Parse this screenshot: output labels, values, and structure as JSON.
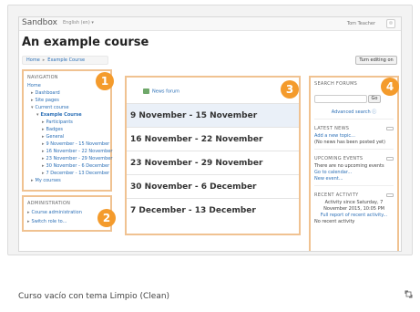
{
  "topbar": {
    "brand": "Sandbox",
    "language": "English (en) ▾",
    "user": "Tom Teacher"
  },
  "course": {
    "title": "An example course",
    "breadcrumb": [
      "Home",
      "Example Course"
    ],
    "edit_button": "Turn editing on"
  },
  "navigation": {
    "heading": "NAVIGATION",
    "items": [
      {
        "label": "Home",
        "level": 0
      },
      {
        "label": "Dashboard",
        "level": 1
      },
      {
        "label": "Site pages",
        "level": 1
      },
      {
        "label": "Current course",
        "level": 1
      },
      {
        "label": "Example Course",
        "level": 2
      },
      {
        "label": "Participants",
        "level": 3
      },
      {
        "label": "Badges",
        "level": 3
      },
      {
        "label": "General",
        "level": 3
      },
      {
        "label": "9 November - 15 November",
        "level": 3
      },
      {
        "label": "16 November - 22 November",
        "level": 3
      },
      {
        "label": "23 November - 29 November",
        "level": 3
      },
      {
        "label": "30 November - 6 December",
        "level": 3
      },
      {
        "label": "7 December - 13 December",
        "level": 3
      },
      {
        "label": "My courses",
        "level": 1
      }
    ]
  },
  "administration": {
    "heading": "ADMINISTRATION",
    "items": [
      "Course administration",
      "Switch role to..."
    ]
  },
  "main": {
    "news_forum": "News forum",
    "weeks": [
      "9 November - 15 November",
      "16 November - 22 November",
      "23 November - 29 November",
      "30 November - 6 December",
      "7 December - 13 December"
    ]
  },
  "search_forums": {
    "heading": "SEARCH FORUMS",
    "go": "Go",
    "advanced": "Advanced search ⓘ"
  },
  "latest_news": {
    "heading": "LATEST NEWS",
    "add_topic": "Add a new topic...",
    "empty": "(No news has been posted yet)"
  },
  "upcoming_events": {
    "heading": "UPCOMING EVENTS",
    "empty": "There are no upcoming events",
    "calendar": "Go to calendar...",
    "new_event": "New event..."
  },
  "recent_activity": {
    "heading": "RECENT ACTIVITY",
    "since": "Activity since Saturday, 7 November 2015, 10:05 PM",
    "full_report": "Full report of recent activity...",
    "none": "No recent activity"
  },
  "markers": [
    "1",
    "2",
    "3",
    "4"
  ],
  "caption": "Curso vacío con tema Limpio (Clean)",
  "colors": {
    "marker": "#f49b2c",
    "block_border": "#f0c291",
    "link": "#2b6fb6"
  }
}
